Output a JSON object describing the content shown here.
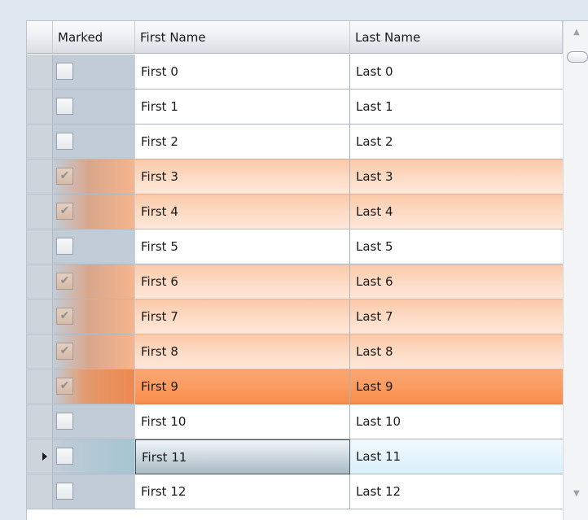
{
  "grid": {
    "columns": {
      "marked": "Marked",
      "first_name": "First Name",
      "last_name": "Last Name"
    },
    "rows": [
      {
        "first": "First 0",
        "last": "Last 0",
        "marked": false
      },
      {
        "first": "First 1",
        "last": "Last 1",
        "marked": false
      },
      {
        "first": "First 2",
        "last": "Last 2",
        "marked": false
      },
      {
        "first": "First 3",
        "last": "Last 3",
        "marked": true
      },
      {
        "first": "First 4",
        "last": "Last 4",
        "marked": true
      },
      {
        "first": "First 5",
        "last": "Last 5",
        "marked": false
      },
      {
        "first": "First 6",
        "last": "Last 6",
        "marked": true
      },
      {
        "first": "First 7",
        "last": "Last 7",
        "marked": true
      },
      {
        "first": "First 8",
        "last": "Last 8",
        "marked": true
      },
      {
        "first": "First 9",
        "last": "Last 9",
        "marked": true,
        "selected": true
      },
      {
        "first": "First 10",
        "last": "Last 10",
        "marked": false
      },
      {
        "first": "First 11",
        "last": "Last 11",
        "marked": false,
        "current": true
      },
      {
        "first": "First 12",
        "last": "Last 12",
        "marked": false
      }
    ],
    "check_glyph": "✔",
    "colors": {
      "marked_row": "#fddcc6",
      "selected_row": "#fb9b5f",
      "current_row": "#d9f0fb"
    }
  },
  "icons": {
    "scroll_up": "chevron-up-icon",
    "scroll_down": "chevron-down-icon",
    "current_row_indicator": "triangle-right-icon"
  }
}
